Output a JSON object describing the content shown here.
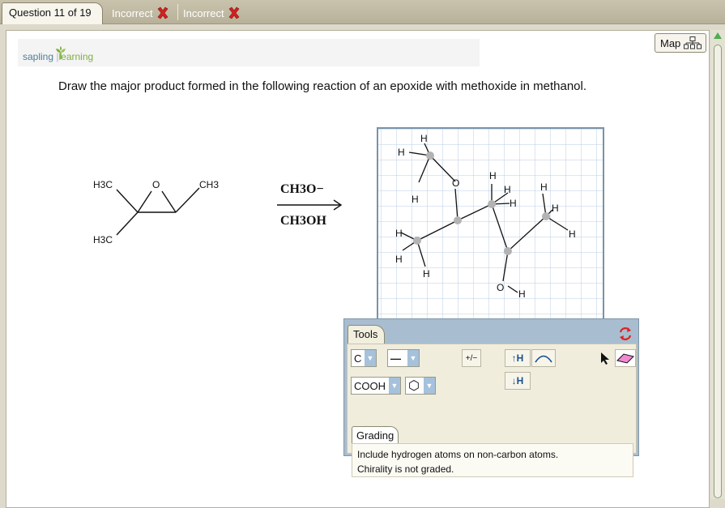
{
  "tabs": {
    "active": "Question 11 of 19",
    "attempts": [
      {
        "label": "Incorrect",
        "icon": "red-x-icon"
      },
      {
        "label": "Incorrect",
        "icon": "red-x-icon"
      }
    ]
  },
  "header": {
    "logo_sapling": "sapling",
    "logo_learning": "learning",
    "map_label": "Map"
  },
  "question": "Draw the major product formed in the following reaction of an epoxide with methoxide in methanol.",
  "reaction": {
    "reactant": {
      "h3c_top": "H3C",
      "o": "O",
      "ch3": "CH3",
      "h3c_bottom": "H3C"
    },
    "reagent_top": "CH3O−",
    "reagent_bottom": "CH3OH"
  },
  "tools": {
    "tab_label": "Tools",
    "element_select": "C",
    "bond_select": "—",
    "group_select": "COOH",
    "ring_select": "⬡",
    "charge_button": "+/−",
    "hup_button": "↑H",
    "hdown_button": "↓H",
    "grading_tab": "Grading",
    "grading_lines": [
      "Include hydrogen atoms on non-carbon atoms.",
      "Chirality is not graded."
    ]
  },
  "colors": {
    "accent_blue": "#a5c1dc",
    "incorrect_red": "#d32020",
    "logo_green": "#7fae42"
  }
}
